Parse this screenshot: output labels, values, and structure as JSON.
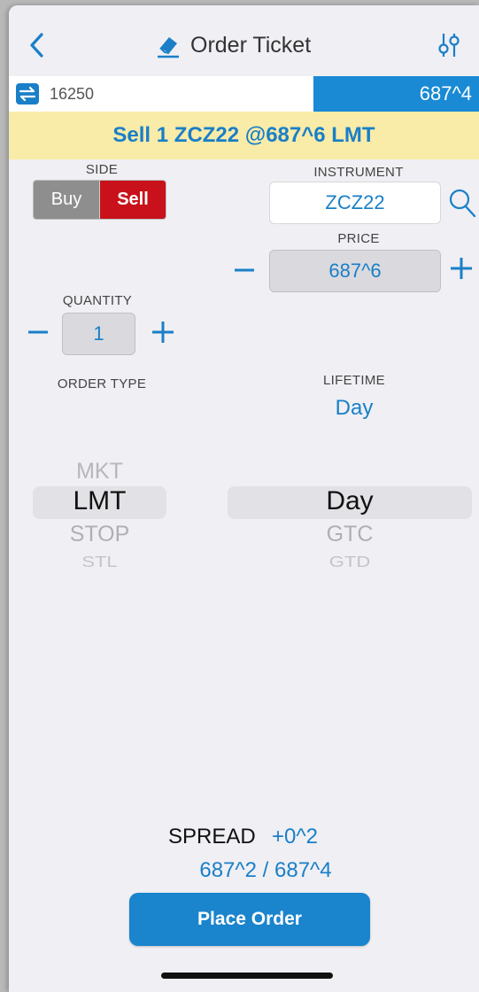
{
  "header": {
    "title": "Order Ticket",
    "back_icon": "chevron-left-icon",
    "title_icon": "eraser-icon",
    "settings_icon": "sliders-icon"
  },
  "ticker": {
    "left_value": "16250",
    "right_value": "687^4",
    "icon": "swap-arrows-icon"
  },
  "summary": {
    "text": "Sell 1 ZCZ22 @687^6 LMT"
  },
  "side": {
    "label": "SIDE",
    "buy_label": "Buy",
    "sell_label": "Sell",
    "selected": "Sell"
  },
  "instrument": {
    "label": "INSTRUMENT",
    "value": "ZCZ22"
  },
  "price": {
    "label": "PRICE",
    "value": "687^6"
  },
  "quantity": {
    "label": "QUANTITY",
    "value": "1"
  },
  "order_type": {
    "label": "ORDER TYPE",
    "options": [
      "MKT",
      "LMT",
      "STOP",
      "STL"
    ],
    "selected": "LMT"
  },
  "lifetime": {
    "label": "LIFETIME",
    "value": "Day",
    "options": [
      "Day",
      "GTC",
      "GTD"
    ],
    "selected": "Day"
  },
  "spread": {
    "label": "SPREAD",
    "value": "+0^2",
    "bid_ask": "687^2 / 687^4"
  },
  "place_order_label": "Place Order",
  "colors": {
    "accent_blue": "#1a84cc",
    "sell_red": "#c8111a",
    "buy_gray": "#8e8e8e",
    "summary_bg": "#f9eba8"
  }
}
